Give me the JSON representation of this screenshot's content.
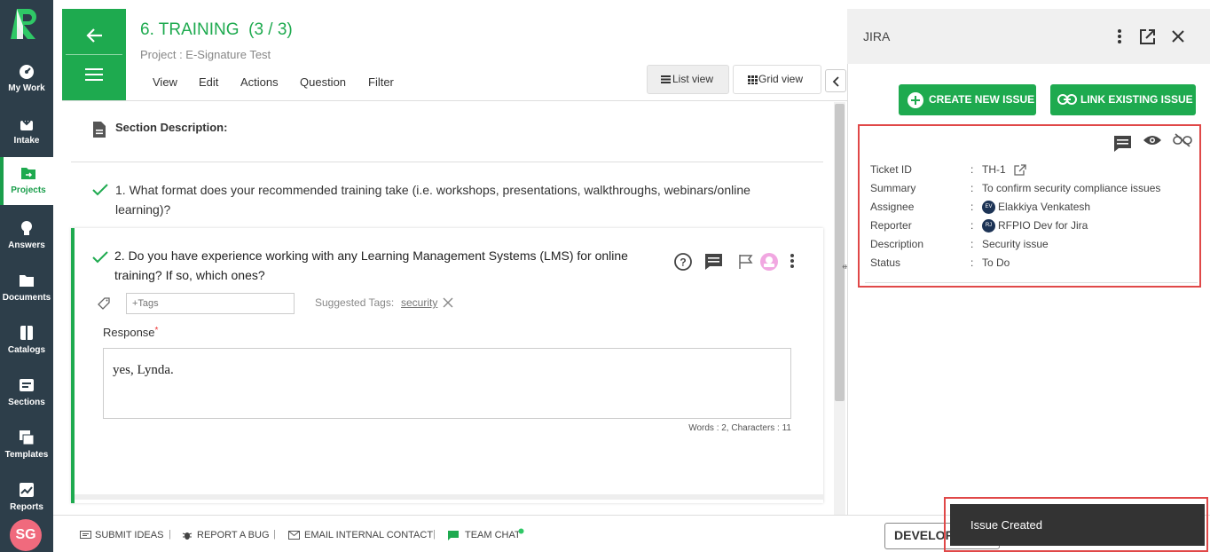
{
  "nav": {
    "items": [
      {
        "label": "My Work",
        "icon": "gauge-icon"
      },
      {
        "label": "Intake",
        "icon": "intake-icon"
      },
      {
        "label": "Projects",
        "icon": "folder-icon"
      },
      {
        "label": "Answers",
        "icon": "lightbulb-icon"
      },
      {
        "label": "Documents",
        "icon": "documents-icon"
      },
      {
        "label": "Catalogs",
        "icon": "book-icon"
      },
      {
        "label": "Sections",
        "icon": "sections-icon"
      },
      {
        "label": "Templates",
        "icon": "templates-icon"
      },
      {
        "label": "Reports",
        "icon": "reports-icon"
      }
    ],
    "active": "Projects",
    "avatar": "SG"
  },
  "header": {
    "title": "6. TRAINING",
    "title_count": "(3 / 3)",
    "subtitle": "Project : E-Signature Test",
    "menu": [
      "View",
      "Edit",
      "Actions",
      "Question",
      "Filter"
    ],
    "list_view": "List view",
    "grid_view": "Grid view"
  },
  "content": {
    "section_description": "Section Description:",
    "q1": "1. What format does your recommended training take (i.e. workshops, presentations, walkthroughs, webinars/online learning)?",
    "q2": "2. Do you have experience working with any Learning Management Systems (LMS) for online training? If so, which ones?",
    "tags_placeholder": "+Tags",
    "suggested_label": "Suggested Tags:",
    "suggested_tag": "security",
    "response_label": "Response",
    "response_required": "*",
    "response_text": "yes, Lynda.",
    "word_count": "Words : 2, Characters : 11"
  },
  "jira": {
    "title": "JIRA",
    "create_button": "CREATE NEW ISSUE",
    "link_button": "LINK EXISTING ISSUE",
    "fields": [
      {
        "key": "Ticket ID",
        "value": "TH-1"
      },
      {
        "key": "Summary",
        "value": "To confirm security compliance issues"
      },
      {
        "key": "Assignee",
        "value": "Elakkiya Venkatesh",
        "initials": "EV"
      },
      {
        "key": "Reporter",
        "value": "RFPIO Dev for Jira",
        "initials": "RJ"
      },
      {
        "key": "Description",
        "value": "Security issue"
      },
      {
        "key": "Status",
        "value": "To Do"
      }
    ],
    "separator": ":"
  },
  "footer": {
    "submit_ideas": "SUBMIT IDEAS",
    "report_bug": "REPORT A BUG",
    "email_contact": "EMAIL INTERNAL CONTACT",
    "team_chat": "TEAM CHAT",
    "separator": "|",
    "env_label": "DEVELOP"
  },
  "toast": {
    "message": "Issue Created"
  },
  "colors": {
    "accent": "#1eaa4f",
    "nav_bg": "#2d3e4a",
    "highlight": "#e04848",
    "toast_bg": "#333333"
  }
}
